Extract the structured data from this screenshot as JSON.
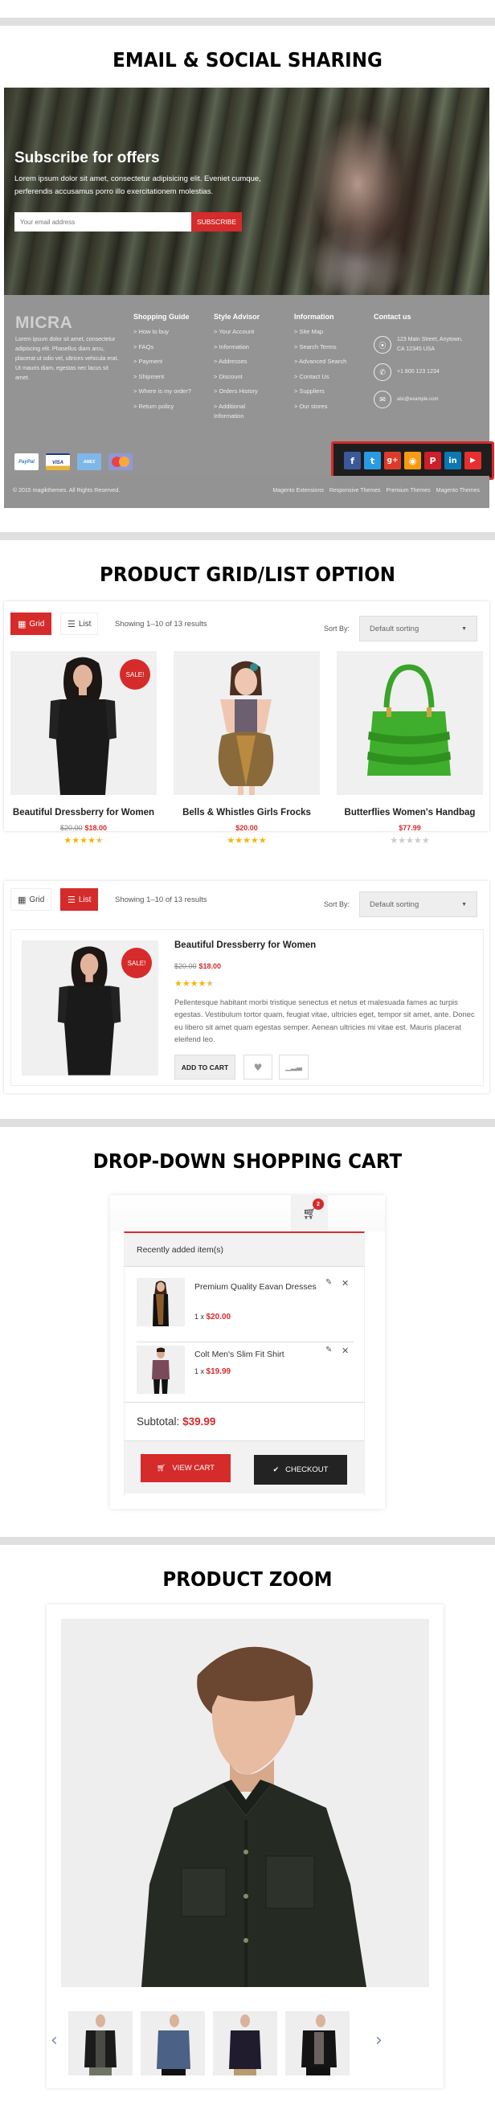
{
  "sections": {
    "email_social": "EMAIL & SOCIAL SHARING",
    "grid_list": "PRODUCT GRID/LIST OPTION",
    "cart": "DROP-DOWN SHOPPING CART",
    "zoom": "PRODUCT ZOOM"
  },
  "newsletter": {
    "title": "Subscribe for offers",
    "text": "Lorem ipsum dolor sit amet, consectetur adipisicing elit. Eveniet cumque, perferendis accusamus porro illo exercitationem molestias.",
    "email_placeholder": "Your email address",
    "subscribe_label": "SUBSCRIBE"
  },
  "footer": {
    "logo": "MICRA",
    "about": "Lorem ipsum dolor sit amet, consectetur adipiscing elit. Phasellus diam arcu, placerat ut odio vel, ultrices vehicula erat. Ut mauris diam, egestas nec lacus sit amet.",
    "columns": [
      {
        "title": "Shopping Guide",
        "links": [
          "> How to buy",
          "> FAQs",
          "> Payment",
          "> Shipment",
          "> Where is my order?",
          "> Return policy"
        ]
      },
      {
        "title": "Style Advisor",
        "links": [
          "> Your Account",
          "> Information",
          "> Addresses",
          "> Discount",
          "> Orders History",
          "> Additional Information"
        ]
      },
      {
        "title": "Information",
        "links": [
          "> Site Map",
          "> Search Terms",
          "> Advanced Search",
          "> Contact Us",
          "> Suppliers",
          "> Our stores"
        ]
      }
    ],
    "contact": {
      "title": "Contact us",
      "address": "123 Main Street, Anytown, CA 12345 USA",
      "phone": "+1 800 123 1234",
      "email": "abc@example.com"
    },
    "payments": [
      "PayPal",
      "VISA",
      "AMEX",
      "MasterCard"
    ],
    "social": [
      {
        "name": "facebook",
        "glyph": "f",
        "color": "#3b5998"
      },
      {
        "name": "twitter",
        "glyph": "t",
        "color": "#2a9ae3"
      },
      {
        "name": "google-plus",
        "glyph": "g+",
        "color": "#dd3b2a"
      },
      {
        "name": "rss",
        "glyph": "◉",
        "color": "#f59a11"
      },
      {
        "name": "pinterest",
        "glyph": "P",
        "color": "#cc1f2b"
      },
      {
        "name": "linkedin",
        "glyph": "in",
        "color": "#0b78b1"
      },
      {
        "name": "youtube",
        "glyph": "▶",
        "color": "#e72f2f"
      }
    ],
    "copyright": "© 2015 magikthemes. All Rights Reserved.",
    "bottom_links": [
      "Magento Extensions",
      "Responsive Themes",
      "Premium Themes",
      "Magento Themes"
    ]
  },
  "listing": {
    "grid_label": "Grid",
    "list_label": "List",
    "showing": "Showing 1–10 of 13 results",
    "sort_label": "Sort By:",
    "sort_value": "Default sorting",
    "sale_badge": "SALE!",
    "products": [
      {
        "name": "Beautiful Dressberry for Women",
        "old_price": "$20.00",
        "price": "$18.00",
        "rating": 4.5,
        "sale": true
      },
      {
        "name": "Bells & Whistles Girls Frocks",
        "old_price": "",
        "price": "$20.00",
        "rating": 5,
        "sale": false
      },
      {
        "name": "Butterflies Women's Handbag",
        "old_price": "",
        "price": "$77.99",
        "rating": 0,
        "sale": false
      }
    ],
    "list_item": {
      "name": "Beautiful Dressberry for Women",
      "old_price": "$20.00",
      "price": "$18.00",
      "rating": 4.5,
      "description": "Pellentesque habitant morbi tristique senectus et netus et malesuada fames ac turpis egestas. Vestibulum tortor quam, feugiat vitae, ultricies eget, tempor sit amet, ante. Donec eu libero sit amet quam egestas semper. Aenean ultricies mi vitae est. Mauris placerat eleifend leo.",
      "add_to_cart": "ADD TO CART"
    }
  },
  "cart": {
    "count": "2",
    "heading": "Recently added item(s)",
    "items": [
      {
        "name": "Premium Quality Eavan Dresses",
        "qty": "1 x",
        "price": "$20.00"
      },
      {
        "name": "Colt Men's Slim Fit Shirt",
        "qty": "1 x",
        "price": "$19.99"
      }
    ],
    "subtotal_label": "Subtotal:",
    "subtotal": "$39.99",
    "view_cart": "VIEW CART",
    "checkout": "CHECKOUT"
  },
  "zoom": {
    "thumbnails": [
      "black cardigan",
      "denim shirt",
      "navy shirt",
      "leather jacket"
    ]
  },
  "colors": {
    "accent": "#d62b2b",
    "star": "#f5b50a",
    "footer_bg": "#949494",
    "dark_button": "#232323"
  }
}
